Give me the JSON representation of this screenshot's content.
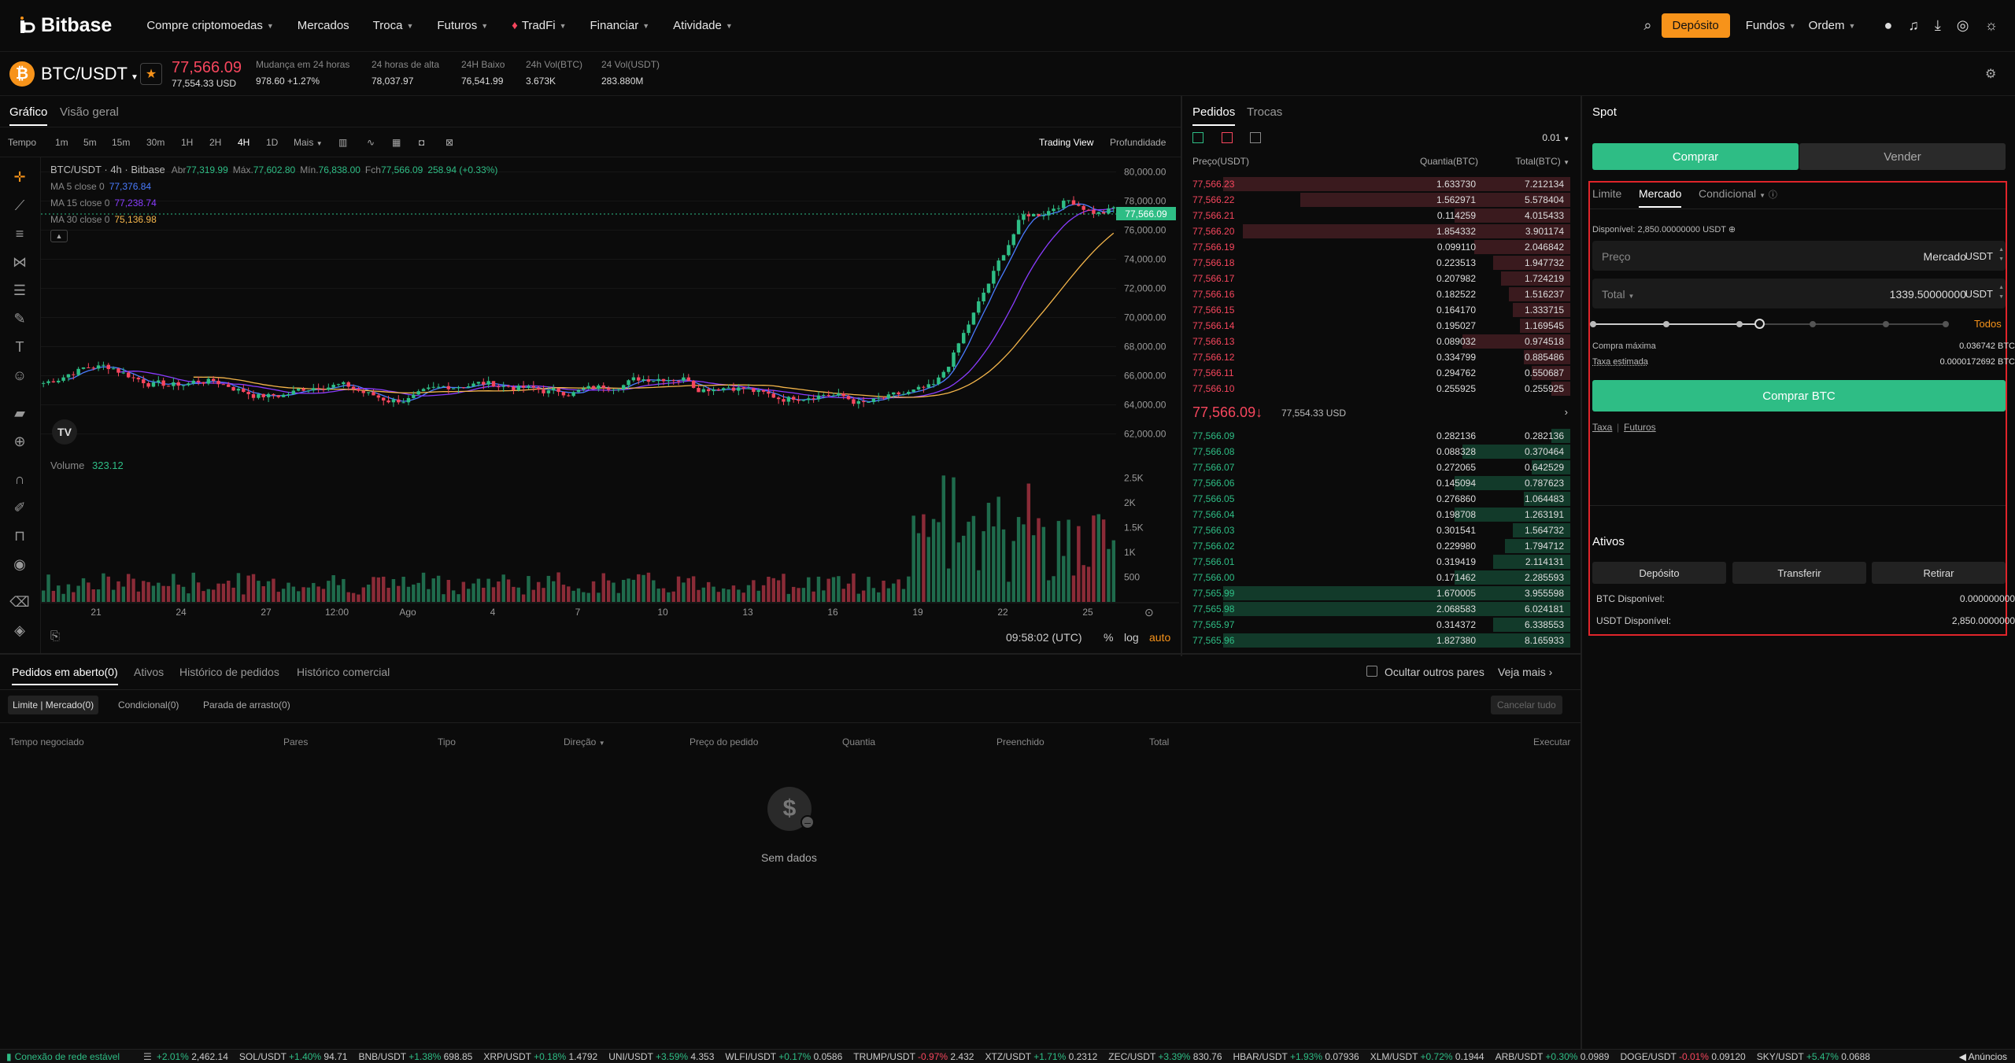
{
  "nav": {
    "logo": "Bitbase",
    "items": [
      "Compre criptomoedas",
      "Mercados",
      "Troca",
      "Futuros",
      "TradFi",
      "Financiar",
      "Atividade"
    ],
    "deposit": "Depósito",
    "funds": "Fundos",
    "order": "Ordem"
  },
  "ticker": {
    "pair": "BTC/USDT",
    "price": "77,566.09",
    "price_usd": "77,554.33 USD",
    "stats": [
      {
        "label": "Mudança em 24 horas",
        "value": "978.60 +1.27%"
      },
      {
        "label": "24 horas de alta",
        "value": "78,037.97"
      },
      {
        "label": "24H Baixo",
        "value": "76,541.99"
      },
      {
        "label": "24h Vol(BTC)",
        "value": "3.673K"
      },
      {
        "label": "24 Vol(USDT)",
        "value": "283.880M"
      }
    ]
  },
  "chart": {
    "tabs": [
      "Gráfico",
      "Visão geral"
    ],
    "toolbar": {
      "tempo": "Tempo",
      "intervals": [
        "1m",
        "5m",
        "15m",
        "30m",
        "1H",
        "2H",
        "4H",
        "1D"
      ],
      "more": "Mais",
      "trading_view": "Trading View",
      "depth": "Profundidade"
    },
    "legend_title": "BTC/USDT · 4h · Bitbase",
    "ohlc": {
      "o_label": "Abr",
      "o": "77,319.99",
      "h_label": "Máx.",
      "h": "77,602.80",
      "l_label": "Mín.",
      "l": "76,838.00",
      "c_label": "Fch",
      "c": "77,566.09",
      "chg": "258.94 (+0.33%)"
    },
    "ma": [
      {
        "label": "MA 5 close 0",
        "value": "77,376.84",
        "color": "#4a7cff"
      },
      {
        "label": "MA 15 close 0",
        "value": "77,238.74",
        "color": "#8a3cff"
      },
      {
        "label": "MA 30 close 0",
        "value": "75,136.98",
        "color": "#f5b64b"
      }
    ],
    "volume_label": "Volume",
    "volume_value": "323.12",
    "price_ticks": [
      "80,000.00",
      "78,000.00",
      "76,000.00",
      "74,000.00",
      "72,000.00",
      "70,000.00",
      "68,000.00",
      "66,000.00",
      "64,000.00",
      "62,000.00"
    ],
    "last_price_tag": "77,566.09",
    "vol_ticks": [
      "2.5K",
      "2K",
      "1.5K",
      "1K",
      "500"
    ],
    "x_ticks": [
      "21",
      "24",
      "27",
      "12:00",
      "Ago",
      "4",
      "7",
      "10",
      "13",
      "16",
      "19",
      "22",
      "25"
    ],
    "time": "09:58:02 (UTC)",
    "pct": "%",
    "log": "log",
    "auto": "auto"
  },
  "chart_data": {
    "type": "candlestick",
    "title": "BTC/USDT · 4h · Bitbase",
    "ylim": [
      61000,
      81000
    ],
    "last": 77566.09
  },
  "orderbook": {
    "tabs": [
      "Pedidos",
      "Trocas"
    ],
    "precision": "0.01",
    "headers": [
      "Preço(USDT)",
      "Quantia(BTC)",
      "Total(BTC)"
    ],
    "asks": [
      [
        "77,566.23",
        "1.633730",
        "7.212134",
        0.9
      ],
      [
        "77,566.22",
        "1.562971",
        "5.578404",
        0.7
      ],
      [
        "77,566.21",
        "0.114259",
        "4.015433",
        0.3
      ],
      [
        "77,566.20",
        "1.854332",
        "3.901174",
        0.85
      ],
      [
        "77,566.19",
        "0.099110",
        "2.046842",
        0.25
      ],
      [
        "77,566.18",
        "0.223513",
        "1.947732",
        0.2
      ],
      [
        "77,566.17",
        "0.207982",
        "1.724219",
        0.18
      ],
      [
        "77,566.16",
        "0.182522",
        "1.516237",
        0.16
      ],
      [
        "77,566.15",
        "0.164170",
        "1.333715",
        0.15
      ],
      [
        "77,566.14",
        "0.195027",
        "1.169545",
        0.13
      ],
      [
        "77,566.13",
        "0.089032",
        "0.974518",
        0.28
      ],
      [
        "77,566.12",
        "0.334799",
        "0.885486",
        0.12
      ],
      [
        "77,566.11",
        "0.294762",
        "0.550687",
        0.1
      ],
      [
        "77,566.10",
        "0.255925",
        "0.255925",
        0.05
      ]
    ],
    "mid_price": "77,566.09",
    "mid_arrow": "↓",
    "mid_usd": "77,554.33 USD",
    "bids": [
      [
        "77,566.09",
        "0.282136",
        "0.282136",
        0.05
      ],
      [
        "77,566.08",
        "0.088328",
        "0.370464",
        0.28
      ],
      [
        "77,566.07",
        "0.272065",
        "0.642529",
        0.1
      ],
      [
        "77,566.06",
        "0.145094",
        "0.787623",
        0.3
      ],
      [
        "77,566.05",
        "0.276860",
        "1.064483",
        0.12
      ],
      [
        "77,566.04",
        "0.198708",
        "1.263191",
        0.3
      ],
      [
        "77,566.03",
        "0.301541",
        "1.564732",
        0.15
      ],
      [
        "77,566.02",
        "0.229980",
        "1.794712",
        0.17
      ],
      [
        "77,566.01",
        "0.319419",
        "2.114131",
        0.2
      ],
      [
        "77,566.00",
        "0.171462",
        "2.285593",
        0.3
      ],
      [
        "77,565.99",
        "1.670005",
        "3.955598",
        0.9
      ],
      [
        "77,565.98",
        "2.068583",
        "6.024181",
        0.9
      ],
      [
        "77,565.97",
        "0.314372",
        "6.338553",
        0.2
      ],
      [
        "77,565.96",
        "1.827380",
        "8.165933",
        0.9
      ]
    ]
  },
  "trade": {
    "title": "Spot",
    "buy": "Comprar",
    "sell": "Vender",
    "types": [
      "Limite",
      "Mercado",
      "Condicional"
    ],
    "available_label": "Disponível:",
    "available": "2,850.00000000 USDT",
    "price_label": "Preço",
    "price_value": "Mercado",
    "unit": "USDT",
    "total_label": "Total",
    "total_value": "1339.50000000",
    "all": "Todos",
    "max_buy_label": "Compra máxima",
    "max_buy": "0.036742 BTC",
    "fee_label": "Taxa estimada",
    "fee": "0.0000172692 BTC",
    "buy_btn": "Comprar BTC",
    "links": [
      "Taxa",
      "Futuros"
    ],
    "slider_pct": 0.47,
    "assets_title": "Ativos",
    "asset_btns": [
      "Depósito",
      "Transferir",
      "Retirar"
    ],
    "btc_label": "BTC Disponível:",
    "btc": "0.000000000",
    "usdt_label": "USDT Disponível:",
    "usdt": "2,850.0000000"
  },
  "bottom": {
    "tabs": [
      "Pedidos em aberto(0)",
      "Ativos",
      "Histórico de pedidos",
      "Histórico comercial"
    ],
    "hide_others": "Ocultar outros pares",
    "see_more": "Veja mais",
    "subtabs": [
      "Limite | Mercado(0)",
      "Condicional(0)",
      "Parada de arrasto(0)"
    ],
    "cancel_all": "Cancelar tudo",
    "columns": [
      "Tempo negociado",
      "Pares",
      "Tipo",
      "Direção",
      "Preço do pedido",
      "Quantia",
      "Preenchido",
      "Total",
      "Executar"
    ],
    "empty": "Sem dados"
  },
  "status": {
    "conn": "Conexão de rede estável",
    "announce": "Anúncios",
    "items": [
      {
        "p": "",
        "c": "+2.01%",
        "v": "2,462.14",
        "up": true
      },
      {
        "p": "SOL/USDT",
        "c": "+1.40%",
        "v": "94.71",
        "up": true
      },
      {
        "p": "BNB/USDT",
        "c": "+1.38%",
        "v": "698.85",
        "up": true
      },
      {
        "p": "XRP/USDT",
        "c": "+0.18%",
        "v": "1.4792",
        "up": true
      },
      {
        "p": "UNI/USDT",
        "c": "+3.59%",
        "v": "4.353",
        "up": true
      },
      {
        "p": "WLFI/USDT",
        "c": "+0.17%",
        "v": "0.0586",
        "up": true
      },
      {
        "p": "TRUMP/USDT",
        "c": "-0.97%",
        "v": "2.432",
        "up": false
      },
      {
        "p": "XTZ/USDT",
        "c": "+1.71%",
        "v": "0.2312",
        "up": true
      },
      {
        "p": "ZEC/USDT",
        "c": "+3.39%",
        "v": "830.76",
        "up": true
      },
      {
        "p": "HBAR/USDT",
        "c": "+1.93%",
        "v": "0.07936",
        "up": true
      },
      {
        "p": "XLM/USDT",
        "c": "+0.72%",
        "v": "0.1944",
        "up": true
      },
      {
        "p": "ARB/USDT",
        "c": "+0.30%",
        "v": "0.0989",
        "up": true
      },
      {
        "p": "DOGE/USDT",
        "c": "-0.01%",
        "v": "0.09120",
        "up": false
      },
      {
        "p": "SKY/USDT",
        "c": "+5.47%",
        "v": "0.0688",
        "up": true
      }
    ]
  }
}
